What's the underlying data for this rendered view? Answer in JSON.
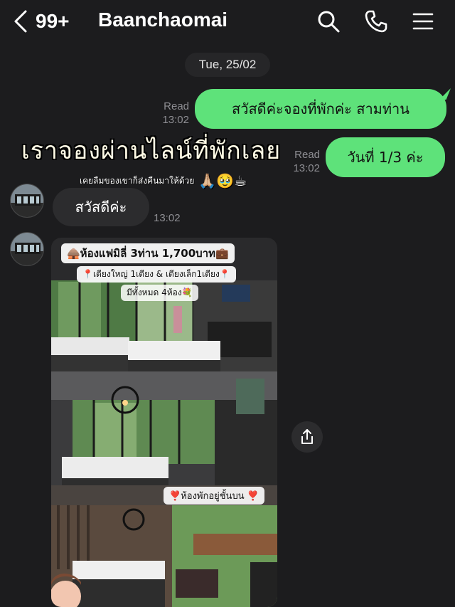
{
  "header": {
    "unread_count": "99+",
    "chat_name": "Baanchaomai",
    "icons": [
      "back-chevron-icon",
      "search-icon",
      "phone-icon",
      "menu-icon"
    ]
  },
  "date_divider": "Tue, 25/02",
  "messages": [
    {
      "direction": "out",
      "text": "สวัสดีค่ะจองที่พักค่ะ สามท่าน",
      "status": "Read",
      "time": "13:02"
    },
    {
      "direction": "out",
      "text": "วันที่ 1/3 ค่ะ",
      "status": "Read",
      "time": "13:02"
    },
    {
      "direction": "in",
      "text": "สวัสดีค่ะ",
      "time": "13:02"
    }
  ],
  "overlay": {
    "headline": "เราจองผ่านไลน์ที่พักเลย",
    "subtext": "เคยลืมของเขาก็ส่งคืนมาให้ด้วย",
    "emoji": "🙏🏼🥹☕"
  },
  "photo": {
    "label_title": "🛖ห้องแฟมิลี่ 3ท่าน  1,700บาท💼",
    "label_beds": "📍เตียงใหญ่ 1เตียง & เตียงเล็ก1เตียง📍",
    "label_rooms": "มีทั้งหมด 4ห้อง💐",
    "label_floor": "❣️ห้องพักอยู่ชั้นบน ❣️"
  },
  "colors": {
    "background": "#1c1c1e",
    "outgoing_bubble": "#5ee27a",
    "incoming_bubble": "#2c2c2e",
    "meta_text": "#8e8e93"
  }
}
